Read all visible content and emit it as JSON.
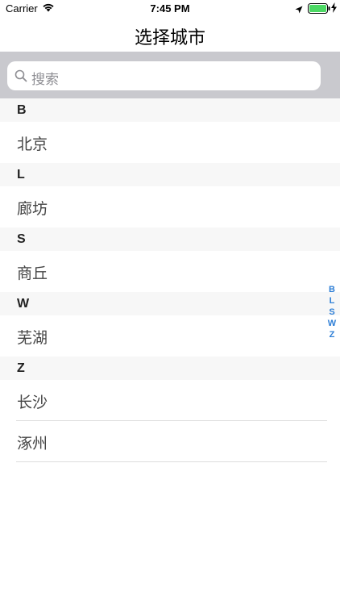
{
  "status_bar": {
    "carrier": "Carrier",
    "time": "7:45 PM",
    "icons": [
      "wifi-icon",
      "location-icon",
      "battery-icon",
      "charging-icon"
    ],
    "battery_color": "#4cd964"
  },
  "nav": {
    "title": "选择城市"
  },
  "search": {
    "placeholder": "搜索",
    "background": "#c9c9ce"
  },
  "sections": [
    {
      "letter": "B",
      "cities": [
        "北京"
      ]
    },
    {
      "letter": "L",
      "cities": [
        "廊坊"
      ]
    },
    {
      "letter": "S",
      "cities": [
        "商丘"
      ]
    },
    {
      "letter": "W",
      "cities": [
        "芜湖"
      ]
    },
    {
      "letter": "Z",
      "cities": [
        "长沙",
        "涿州"
      ]
    }
  ],
  "index": [
    "B",
    "L",
    "S",
    "W",
    "Z"
  ],
  "accent_color": "#2f7fd6"
}
